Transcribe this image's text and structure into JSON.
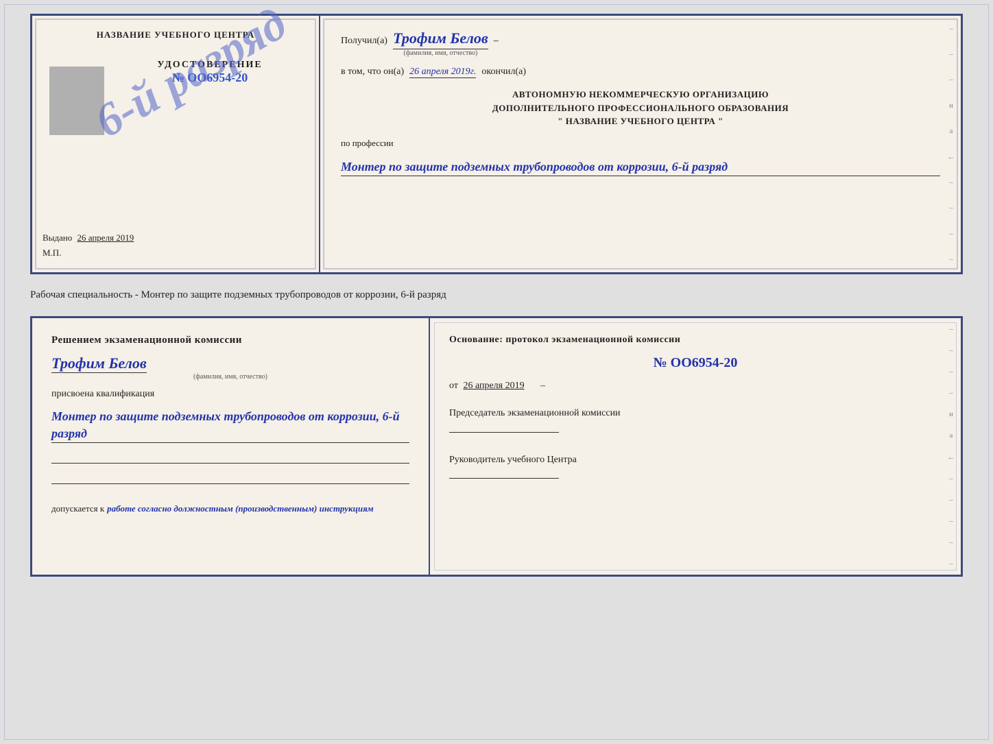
{
  "top_cert": {
    "org_name_label": "НАЗВАНИЕ УЧЕБНОГО ЦЕНТРА",
    "stamp_text": "6-й разряд",
    "cert_type": "УДОСТОВЕРЕНИЕ",
    "cert_number": "№ OO6954-20",
    "issued_label": "Выдано",
    "issued_date": "26 апреля 2019",
    "mp": "М.П.",
    "received_label": "Получил(а)",
    "received_name": "Трофим Белов",
    "name_subtitle": "(фамилия, имя, отчество)",
    "in_that_label": "в том, что он(а)",
    "in_that_date": "26 апреля 2019г.",
    "finished_label": "окончил(а)",
    "org_line1": "АВТОНОМНУЮ НЕКОММЕРЧЕСКУЮ ОРГАНИЗАЦИЮ",
    "org_line2": "ДОПОЛНИТЕЛЬНОГО ПРОФЕССИОНАЛЬНОГО ОБРАЗОВАНИЯ",
    "org_line3": "\"   НАЗВАНИЕ УЧЕБНОГО ЦЕНТРА   \"",
    "profession_label": "по профессии",
    "profession_value": "Монтер по защите подземных трубопроводов от коррозии, 6-й разряд",
    "sidebar_dashes": [
      "-",
      "-",
      "-",
      "и",
      "а",
      "←",
      "-",
      "-",
      "-",
      "-"
    ]
  },
  "speciality_text": "Рабочая специальность - Монтер по защите подземных трубопроводов от коррозии, 6-й разряд",
  "bottom_cert": {
    "decision_title": "Решением экзаменационной комиссии",
    "person_name": "Трофим Белов",
    "name_subtitle": "(фамилия, имя, отчество)",
    "assigned_label": "присвоена квалификация",
    "profession_value": "Монтер по защите подземных трубопроводов от коррозии, 6-й разряд",
    "allowed_label": "допускается к",
    "allowed_value": "работе согласно должностным (производственным) инструкциям",
    "basis_title": "Основание: протокол экзаменационной комиссии",
    "protocol_number": "№ OO6954-20",
    "protocol_date_prefix": "от",
    "protocol_date": "26 апреля 2019",
    "chairman_label": "Председатель экзаменационной комиссии",
    "head_label": "Руководитель учебного Центра",
    "sidebar_dashes": [
      "-",
      "-",
      "-",
      "-",
      "и",
      "а",
      "←",
      "-",
      "-",
      "-",
      "-",
      "-"
    ]
  }
}
